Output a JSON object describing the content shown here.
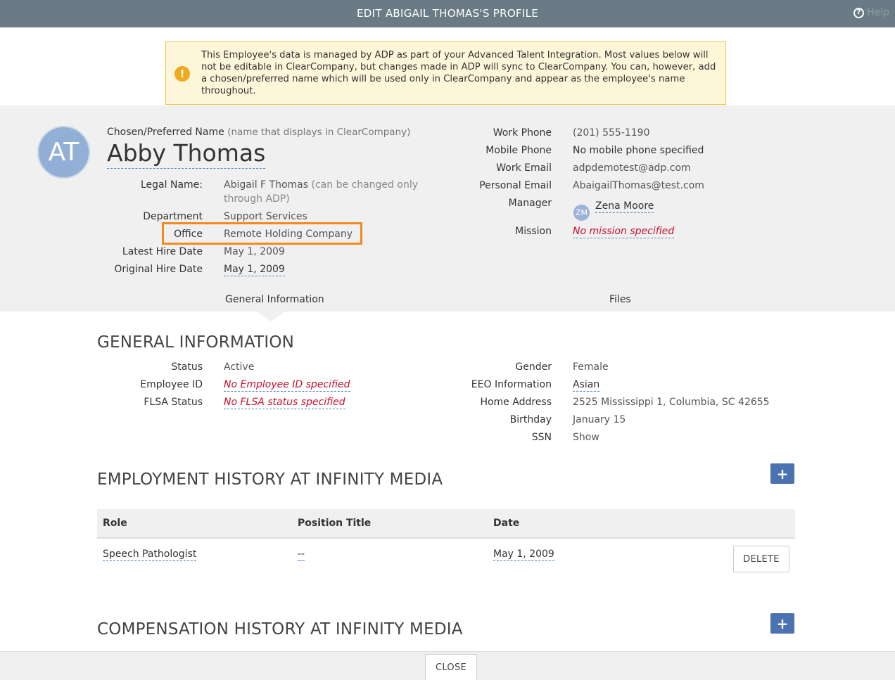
{
  "window": {
    "title": "EDIT ABIGAIL THOMAS'S PROFILE",
    "help_label": "Help"
  },
  "alert": {
    "message": "This Employee's data is managed by ADP as part of your Advanced Talent Integration. Most values below will not be editable in ClearCompany, but changes made in ADP will sync to ClearCompany. You can, however, add a chosen/preferred name which will be used only in ClearCompany and appear as the employee's name throughout."
  },
  "profile": {
    "avatar_initials": "AT",
    "preferred_label": "Chosen/Preferred Name",
    "preferred_note": "(name that displays in ClearCompany)",
    "display_name": "Abby Thomas",
    "legal_name_label": "Legal Name:",
    "legal_name": "Abigail F Thomas",
    "legal_name_note_1": "(can be changed only",
    "legal_name_note_2": "through ADP)",
    "department_label": "Department",
    "department": "Support Services",
    "office_label": "Office",
    "office": "Remote Holding Company",
    "latest_hire_label": "Latest Hire Date",
    "latest_hire": "May 1, 2009",
    "original_hire_label": "Original Hire Date",
    "original_hire": "May 1, 2009",
    "work_phone_label": "Work Phone",
    "work_phone": "(201) 555-1190",
    "mobile_phone_label": "Mobile Phone",
    "mobile_phone": "No mobile phone specified",
    "work_email_label": "Work Email",
    "work_email": "adpdemotest@adp.com",
    "personal_email_label": "Personal Email",
    "personal_email": "AbaigailThomas@test.com",
    "manager_label": "Manager",
    "manager_initials": "ZM",
    "manager_name": "Zena Moore",
    "mission_label": "Mission",
    "mission": "No mission specified"
  },
  "tabs": [
    {
      "label": "General Information"
    },
    {
      "label": "Files"
    }
  ],
  "general": {
    "title": "GENERAL INFORMATION",
    "status_label": "Status",
    "status": "Active",
    "employee_id_label": "Employee ID",
    "employee_id": "No Employee ID specified",
    "flsa_label": "FLSA Status",
    "flsa": "No FLSA status specified",
    "gender_label": "Gender",
    "gender": "Female",
    "eeo_label": "EEO Information",
    "eeo": "Asian",
    "address_label": "Home Address",
    "address": "2525 Mississippi 1, Columbia, SC 42655",
    "birthday_label": "Birthday",
    "birthday": "January 15",
    "ssn_label": "SSN",
    "ssn": "Show"
  },
  "employment": {
    "title": "EMPLOYMENT HISTORY AT INFINITY MEDIA",
    "add_label": "+",
    "columns": [
      "Role",
      "Position Title",
      "Date"
    ],
    "rows": [
      {
        "role": "Speech Pathologist",
        "position_title": "--",
        "date": "May 1, 2009",
        "delete_label": "DELETE"
      }
    ]
  },
  "compensation": {
    "title": "COMPENSATION HISTORY AT INFINITY MEDIA",
    "add_label": "+"
  },
  "footer": {
    "close_label": "CLOSE"
  },
  "colors": {
    "titlebar": "#6a7b85",
    "accent_blue": "#4a72b0",
    "highlight_orange": "#f4891f",
    "empty_red": "#c8102e",
    "alert_bg": "#fdf6d9"
  }
}
